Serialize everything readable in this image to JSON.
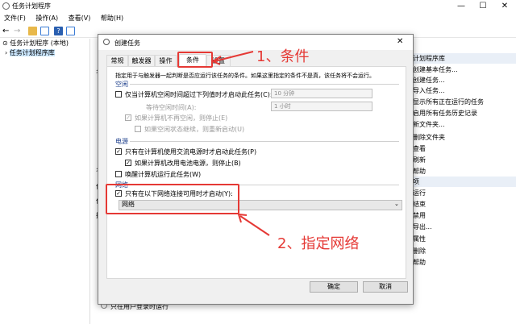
{
  "window": {
    "title": "任务计划程序",
    "minimize": "—",
    "maximize": "☐",
    "close": "✕"
  },
  "menu": [
    "文件(F)",
    "操作(A)",
    "查看(V)",
    "帮助(H)"
  ],
  "tree": {
    "root": "任务计划程序 (本地)",
    "child": "任务计划程序库"
  },
  "actions": {
    "header": "计划程序库",
    "items": [
      "创建基本任务...",
      "创建任务...",
      "导入任务...",
      "显示所有正在运行的任务",
      "启用所有任务历史记录",
      "新文件夹...",
      "删除文件夹",
      "查看",
      "刷新",
      "帮助"
    ],
    "sub_header": "项",
    "sub_items": [
      "运行",
      "结束",
      "禁用",
      "导出...",
      "属性",
      "删除",
      "帮助"
    ]
  },
  "behind": {
    "col1": "名",
    "row1": "常",
    "row2": "名",
    "row3": "位",
    "row4": "作",
    "row5": "描",
    "radio_label": "只在用户登录时运行"
  },
  "dialog": {
    "title": "创建任务",
    "tabs": [
      "常规",
      "触发器",
      "操作",
      "条件",
      "设置"
    ],
    "description": "指定用于与触发器一起判断是否应运行该任务的条件。如果这里指定的条件不是真，该任务将不会运行。",
    "idle": {
      "section": "空闲",
      "start_label": "仅当计算机空闲时间超过下列值时才启动此任务(C):",
      "start_value": "10 分钟",
      "wait_label": "等待空闲时间(A):",
      "wait_value": "1 小时",
      "stop_label": "如果计算机不再空闲，则停止(E)",
      "restart_label": "如果空闲状态继续，则重新启动(U)"
    },
    "power": {
      "section": "电源",
      "ac_label": "只有在计算机使用交流电源时才启动此任务(P)",
      "battery_label": "如果计算机改用电池电源，则停止(B)",
      "wake_label": "唤醒计算机运行此任务(W)"
    },
    "network": {
      "section": "网络",
      "label": "只有在以下网络连接可用时才启动(Y):",
      "value": "网络"
    },
    "ok": "确定",
    "cancel": "取消"
  },
  "annotations": {
    "step1": "1、条件",
    "step2": "2、指定网络"
  },
  "colors": {
    "annotation": "#e53935",
    "selection": "#cce8ff"
  }
}
